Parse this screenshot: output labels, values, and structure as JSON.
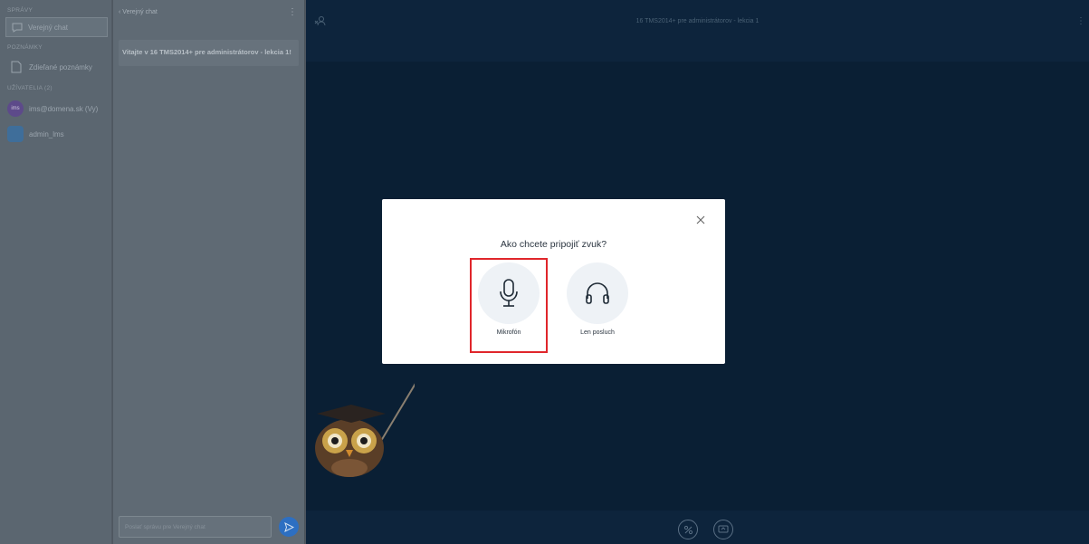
{
  "sidebar": {
    "messages_header": "SPRÁVY",
    "public_chat": "Verejný chat",
    "notes_header": "POZNÁMKY",
    "shared_notes": "Zdieľané poznámky",
    "users_header": "UŽÍVATELIA (2)",
    "users": [
      {
        "initials": "ims",
        "name": "ims@domena.sk (Vy)"
      },
      {
        "initials": "ad",
        "name": "admin_lms"
      }
    ]
  },
  "chat": {
    "back_label": "Verejný chat",
    "welcome_text": "Vitajte v 16 TMS2014+ pre administrátorov - lekcia 1!",
    "input_placeholder": "Poslať správu pre Verejný chat"
  },
  "meeting": {
    "title": "16 TMS2014+ pre administrátorov - lekcia 1"
  },
  "modal": {
    "question": "Ako chcete pripojiť zvuk?",
    "microphone_label": "Mikrofón",
    "listen_only_label": "Len posluch"
  },
  "colors": {
    "highlight": "#e0262b",
    "send_button": "#2d6fc2",
    "main_bg": "#0b2037"
  }
}
